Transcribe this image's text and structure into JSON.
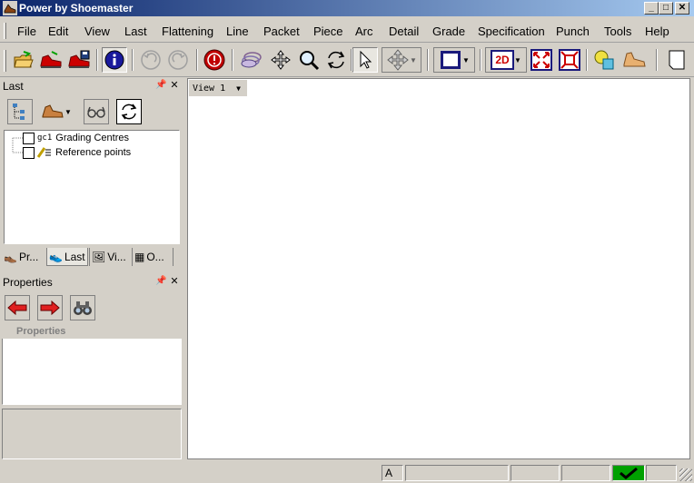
{
  "window": {
    "title": "Power by Shoemaster"
  },
  "menu": [
    "File",
    "Edit",
    "View",
    "Last",
    "Flattening",
    "Line",
    "Packet",
    "Piece",
    "Arc",
    "Detail",
    "Grade",
    "Specification",
    "Punch",
    "Tools",
    "Help"
  ],
  "toolbar": {
    "icons": [
      "open-icon",
      "red-shoe-icon",
      "shoe-save-icon",
      "info-icon",
      "undo-icon",
      "redo-icon",
      "stop-icon",
      "layers-icon",
      "move-icon",
      "zoom-icon",
      "rotate-icon",
      "select-arrow-icon",
      "pan-icon",
      "color-box-icon",
      "2d-mode-icon",
      "zoom-fit-icon",
      "zoom-extents-icon",
      "shapes-icon",
      "last-shoe-icon",
      "new-page-icon"
    ],
    "mode_label": "2D"
  },
  "last_panel": {
    "title": "Last",
    "tree": [
      {
        "prefix": "gc1",
        "label": "Grading Centres"
      },
      {
        "prefix": "",
        "label": "Reference points"
      }
    ],
    "tabs": [
      "Pr...",
      "Last",
      "Vi...",
      "O..."
    ]
  },
  "properties_panel": {
    "title": "Properties",
    "section_header": "Properties"
  },
  "view": {
    "tab_label": "View 1"
  },
  "status": {
    "cell1": "A"
  },
  "colors": {
    "title_start": "#0a246a",
    "title_end": "#a6caf0",
    "chrome": "#d4d0c8",
    "accent_red": "#cc0000",
    "ok_green": "#00a000"
  }
}
